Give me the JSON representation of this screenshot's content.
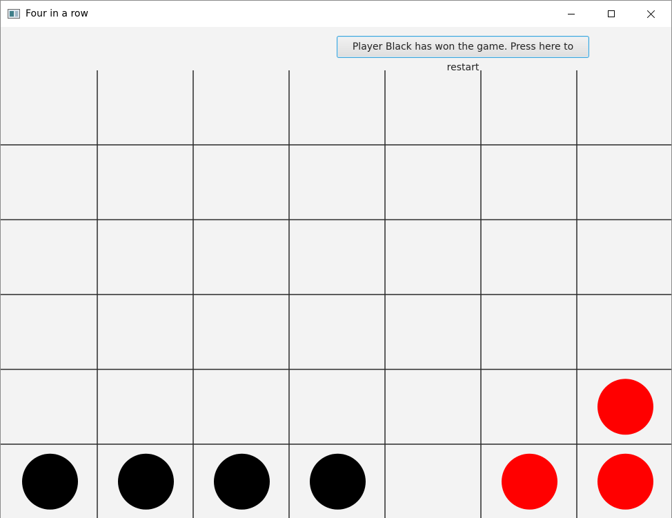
{
  "window": {
    "title": "Four in a row",
    "controls": [
      "minimize",
      "maximize",
      "close"
    ]
  },
  "status_button": {
    "label": "Player Black has won the game. Press here to restart"
  },
  "board": {
    "columns": 7,
    "rows": 6,
    "pieces": [
      {
        "row": 5,
        "col": 0,
        "player": "black"
      },
      {
        "row": 5,
        "col": 1,
        "player": "black"
      },
      {
        "row": 5,
        "col": 2,
        "player": "black"
      },
      {
        "row": 5,
        "col": 3,
        "player": "black"
      },
      {
        "row": 5,
        "col": 5,
        "player": "red"
      },
      {
        "row": 5,
        "col": 6,
        "player": "red"
      },
      {
        "row": 4,
        "col": 6,
        "player": "red"
      }
    ],
    "colors": {
      "black": "#000000",
      "red": "#ff0000",
      "grid": "#2b2b2b",
      "background": "#f3f3f3"
    }
  }
}
